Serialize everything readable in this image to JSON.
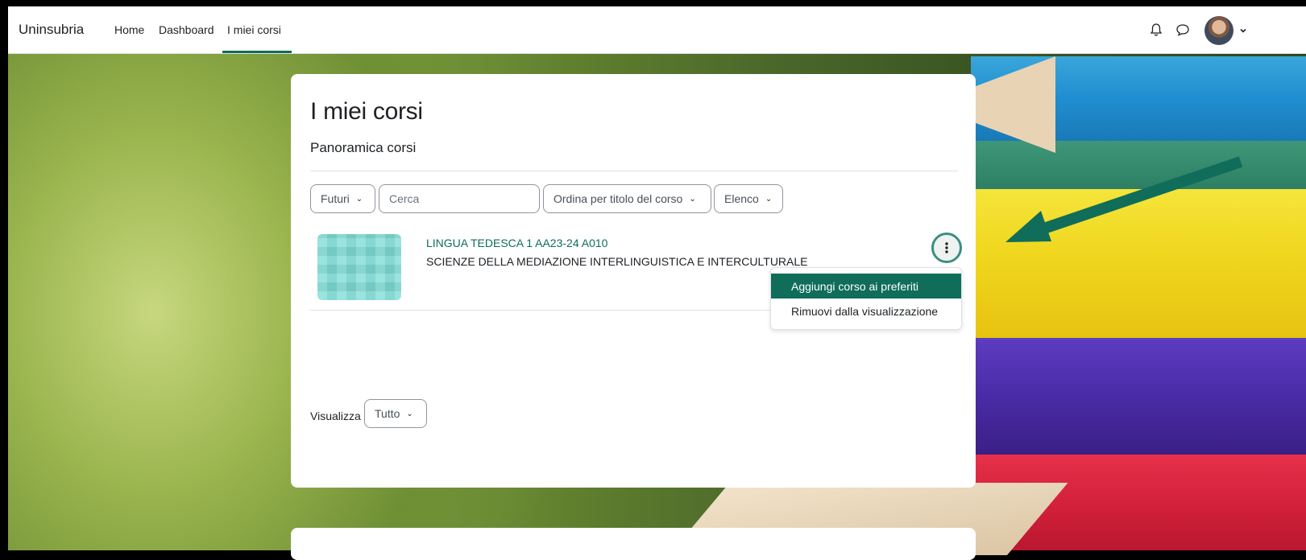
{
  "navbar": {
    "brand": "Uninsubria",
    "links": [
      {
        "label": "Home"
      },
      {
        "label": "Dashboard"
      },
      {
        "label": "I miei corsi",
        "active": true
      }
    ],
    "icons": [
      "bell-icon",
      "chat-icon",
      "avatar",
      "chevron-down-icon"
    ]
  },
  "page": {
    "title": "I miei corsi",
    "section": "Panoramica corsi"
  },
  "filters": {
    "grouping": "Futuri",
    "search_placeholder": "Cerca",
    "sort": "Ordina per titolo del corso",
    "view": "Elenco"
  },
  "courses": [
    {
      "name": "LINGUA TEDESCA 1 AA23-24 A010",
      "category": "SCIENZE DELLA MEDIAZIONE INTERLINGUISTICA E INTERCULTURALE"
    }
  ],
  "course_menu": {
    "items": [
      "Aggiungi corso ai preferiti",
      "Rimuovi dalla visualizzazione"
    ],
    "highlighted_index": 0
  },
  "paging": {
    "label": "Visualizza",
    "value": "Tutto"
  },
  "colors": {
    "accent": "#0f6d5a",
    "annotation_arrow": "#0f6d5a"
  }
}
